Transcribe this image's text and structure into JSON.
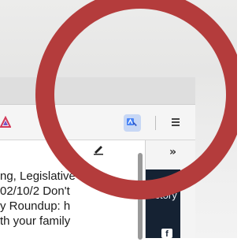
{
  "panel": {
    "lines": [
      "ng, Legislative",
      "02/10/2  Don't",
      "y Roundup:  h",
      "th your family"
    ]
  },
  "sidebar": {
    "label": "rectory",
    "chevron": "»",
    "social_icon": "f"
  },
  "icons": {
    "extension_left": "triangle-icon",
    "extension_right": "google-translate-icon",
    "menu": "menu-icon",
    "edit": "pencil-icon"
  },
  "colors": {
    "ring": "#b43c3c",
    "extension_right_bg": "#c7d7f5",
    "dark_panel": "#152233"
  }
}
